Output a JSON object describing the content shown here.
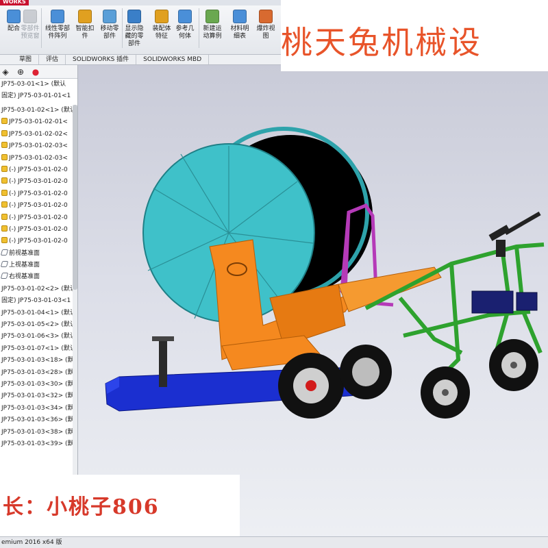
{
  "brand": "WORKS",
  "ribbon": {
    "tools": [
      {
        "label": "配合"
      },
      {
        "label": "零部件\n预览窗",
        "disabled": true
      },
      {
        "label": "线性零部\n件阵列"
      },
      {
        "label": "智能扣\n件"
      },
      {
        "label": "移动零\n部件"
      },
      {
        "label": "显示隐\n藏的零\n部件"
      },
      {
        "label": "装配体\n特征"
      },
      {
        "label": "参考几\n何体"
      },
      {
        "label": "新建运\n动算例"
      },
      {
        "label": "材料明\n细表"
      },
      {
        "label": "爆炸视\n图"
      }
    ]
  },
  "tabs": [
    "草图",
    "评估",
    "SOLIDWORKS 插件",
    "SOLIDWORKS MBD"
  ],
  "tree": {
    "head": [
      " JP75-03-01<1> (默认",
      "固定) JP75-03-01-01<1"
    ],
    "items": [
      {
        "label": "JP75-03-01-02<1> (默认",
        "type": "asm"
      },
      {
        "label": "JP75-03-01-02-01<",
        "type": "part"
      },
      {
        "label": "JP75-03-01-02-02<",
        "type": "part"
      },
      {
        "label": "JP75-03-01-02-03<",
        "type": "part"
      },
      {
        "label": "JP75-03-01-02-03<",
        "type": "part"
      },
      {
        "label": "(-) JP75-03-01-02-0",
        "type": "part"
      },
      {
        "label": "(-) JP75-03-01-02-0",
        "type": "part"
      },
      {
        "label": "(-) JP75-03-01-02-0",
        "type": "part"
      },
      {
        "label": "(-) JP75-03-01-02-0",
        "type": "part"
      },
      {
        "label": "(-) JP75-03-01-02-0",
        "type": "part"
      },
      {
        "label": "(-) JP75-03-01-02-0",
        "type": "part"
      },
      {
        "label": "(-) JP75-03-01-02-0",
        "type": "part"
      },
      {
        "label": "前视基准面",
        "type": "plane"
      },
      {
        "label": "上视基准面",
        "type": "plane"
      },
      {
        "label": "右视基准面",
        "type": "plane"
      },
      {
        "label": "JP75-03-01-02<2> (默认",
        "type": "asm"
      },
      {
        "label": "固定) JP75-03-01-03<1",
        "type": "asm"
      },
      {
        "label": "JP75-03-01-04<1> (默认",
        "type": "asm"
      },
      {
        "label": "JP75-03-01-05<2> (默认",
        "type": "asm"
      },
      {
        "label": "JP75-03-01-06<3> (默认",
        "type": "asm"
      },
      {
        "label": "JP75-03-01-07<1> (默认",
        "type": "asm"
      },
      {
        "label": "JP75-03-01-03<18> (默",
        "type": "asm"
      },
      {
        "label": "JP75-03-01-03<28> (默",
        "type": "asm"
      },
      {
        "label": "JP75-03-01-03<30> (默",
        "type": "asm"
      },
      {
        "label": "JP75-03-01-03<32> (默",
        "type": "asm"
      },
      {
        "label": "JP75-03-01-03<34> (默",
        "type": "asm"
      },
      {
        "label": "JP75-03-01-03<36> (默",
        "type": "asm"
      },
      {
        "label": "JP75-03-01-03<38> (默",
        "type": "asm"
      },
      {
        "label": "JP75-03-01-03<39> (默",
        "type": "asm"
      }
    ]
  },
  "watermark_title": "桃天兔机械设",
  "watermark_shop": "长：小桃子806",
  "status_text": "emium 2016 x64 版",
  "colors": {
    "drum": "#3fc1c9",
    "frame": "#f5891f",
    "hose": "#000000",
    "guard": "#b53ab8",
    "cart": "#3bd13b",
    "base": "#1b2fd0",
    "tire": "#111111"
  }
}
